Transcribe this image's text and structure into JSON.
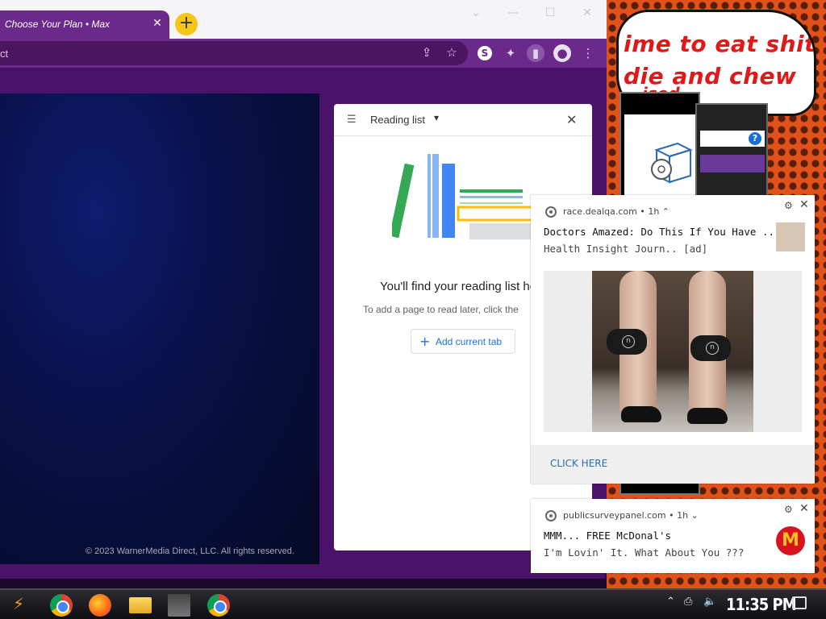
{
  "browser": {
    "tab_title": "Choose Your Plan • Max",
    "tab_close": "✕",
    "new_tab": "+",
    "window_controls": {
      "dropdown": "⌄",
      "minimize": "—",
      "maximize": "☐",
      "close": "✕"
    },
    "omnibox_text": "ct",
    "toolbar_icons": [
      "share-icon",
      "star-icon",
      "extension-s-icon",
      "puzzle-icon",
      "reading-list-icon",
      "profile-icon",
      "menu-icon"
    ],
    "extension_s_label": "S"
  },
  "page": {
    "footer": "© 2023 WarnerMedia Direct, LLC. All rights reserved."
  },
  "reading_list": {
    "title": "Reading list",
    "heading": "You'll find your reading list he",
    "subtext": "To add a page to read later, click the",
    "add_button": "Add current tab",
    "add_plus": "+",
    "close": "✕",
    "caret": "▾"
  },
  "notifications": [
    {
      "source": "race.dealqa.com",
      "age": "• 1h ⌃",
      "title": "Doctors Amazed: Do This If You Have ...",
      "body": "Health Insight Journ.. [ad]",
      "cta": "CLICK HERE"
    },
    {
      "source": "publicsurveypanel.com",
      "age": "• 1h ⌄",
      "title": "MMM... FREE McDonal's",
      "body": "I'm Lovin' It. What About You ???",
      "logo_letter": "M"
    }
  ],
  "wallpaper": {
    "speech_text": "ime to eat shit die and chew",
    "speech_peek": "ised"
  },
  "taskbar": {
    "apps": [
      "start-icon",
      "chrome-icon",
      "firefox-icon",
      "file-explorer-icon",
      "image-app-icon",
      "chrome-icon"
    ],
    "clock": "11:35 PM"
  }
}
